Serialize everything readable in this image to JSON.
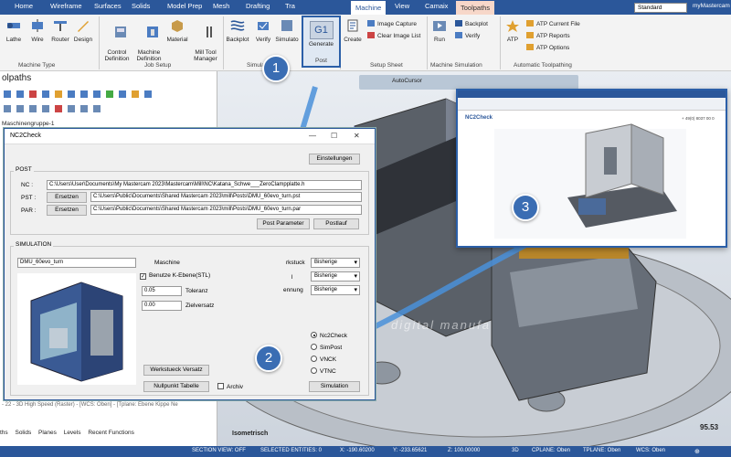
{
  "ribbon_tabs": {
    "home": "Home",
    "wireframe": "Wireframe",
    "surfaces": "Surfaces",
    "solids": "Solids",
    "model_prep": "Model Prep",
    "mesh": "Mesh",
    "drafting": "Drafting",
    "trans": "Tra",
    "machine": "Machine",
    "view": "View",
    "camaix": "Camaix",
    "toolpaths": "Toolpaths",
    "standard": "Standard",
    "user": "myMastercam"
  },
  "ribbon": {
    "lathe": "Lathe",
    "wire": "Wire",
    "router": "Router",
    "design": "Design",
    "group_machine_type": "Machine Type",
    "control_definition": "Control\nDefinition",
    "machine_definition": "Machine\nDefinition",
    "material": "Material",
    "mill_tool_manager": "Mill Tool\nManager",
    "group_job_setup": "Job Setup",
    "backplot": "Backplot",
    "verify": "Verify",
    "simulator": "Simulato",
    "group_simulation": "Simula",
    "g1_label": "G1",
    "generate": "Generate",
    "group_post": "Post",
    "create": "Create",
    "image_capture": "Image Capture",
    "clear_image_list": "Clear Image List",
    "group_setup_sheet": "Setup Sheet",
    "run": "Run",
    "backplot2": "Backplot",
    "verify2": "Verify",
    "group_machine_simulation": "Machine Simulation",
    "atp": "ATP",
    "atp_current_file": "ATP Current File",
    "atp_reports": "ATP Reports",
    "atp_options": "ATP Options",
    "group_automatic_toolpathing": "Automatic Toolpathing"
  },
  "left_panel": {
    "title": "olpaths",
    "tree_item": "Maschinengruppe-1",
    "op_line": "- 22 - 3D High Speed (Raster) - [WCS: Oben] - [Tplane: Ebene Kippe Ne",
    "bottom_tabs": [
      "ths",
      "Solids",
      "Planes",
      "Levels",
      "Recent Functions"
    ]
  },
  "viewport": {
    "autocursor": "AutoCursor",
    "view_name": "Isometrisch",
    "scale": "95.53",
    "watermark": "digital manufa"
  },
  "dialog": {
    "title": "NC2Check",
    "settings_button": "Einstellungen",
    "post_group": "POST",
    "nc_label": "NC :",
    "nc_path": "C:\\Users\\User\\Documents\\My Mastercam 2023\\Mastercam\\Mill\\NC\\Katana_Schwe___ZeroClampplatte.h",
    "pst_label": "PST :",
    "pst_path": "C:\\Users\\Public\\Documents\\Shared Mastercam 2023\\mill\\Posts\\DMU_60evo_turn.pst",
    "par_label": "PAR :",
    "par_path": "C:\\Users\\Public\\Documents\\Shared Mastercam 2023\\mill\\Posts\\DMU_60evo_turn.par",
    "replace_button_1": "Ersetzen",
    "replace_button_2": "Ersetzen",
    "post_parameter_button": "Post Parameter",
    "post_run_button": "Postlauf",
    "simulation_group": "SIMULATION",
    "machine_field": "DMU_60evo_turn",
    "machine_label": "Maschine",
    "use_k_plane": "Benutze K-Ebene(STL)",
    "tolerance_value": "0.05",
    "tolerance_label": "Toleranz",
    "target_offset_value": "0.00",
    "target_offset_label": "Zielversatz",
    "workpiece_label": "rkstuck",
    "fixture_label": "l",
    "clamp_label": "ennung",
    "select_1": "Bisherige",
    "select_2": "Bisherige",
    "select_3": "Bisherige",
    "workpiece_offset_button": "Werkstueck Versatz",
    "zero_point_table_button": "Nullpunkt Tabelle",
    "archive_label": "Archiv",
    "simulators": [
      "Nc2Check",
      "SimPost",
      "VNCK",
      "VTNC"
    ],
    "simulation_button": "Simulation"
  },
  "badges": [
    "1",
    "2",
    "3"
  ],
  "inset": {
    "brand": "NC2Check",
    "phone": "+ 49(0) 8037 00 0"
  },
  "status_bar": {
    "section_view": "SECTION VIEW: OFF",
    "selected": "SELECTED ENTITIES: 0",
    "x": "X:   -190.60200",
    "y": "Y:   -233.65621",
    "z": "Z:   100.00000",
    "mode": "3D",
    "cplane": "CPLANE: Oben",
    "tplane": "TPLANE: Oben",
    "wcs": "WCS: Oben"
  },
  "colors": {
    "accent": "#2b579a",
    "badge": "#3a6db3",
    "arrow": "#4a90d9"
  }
}
